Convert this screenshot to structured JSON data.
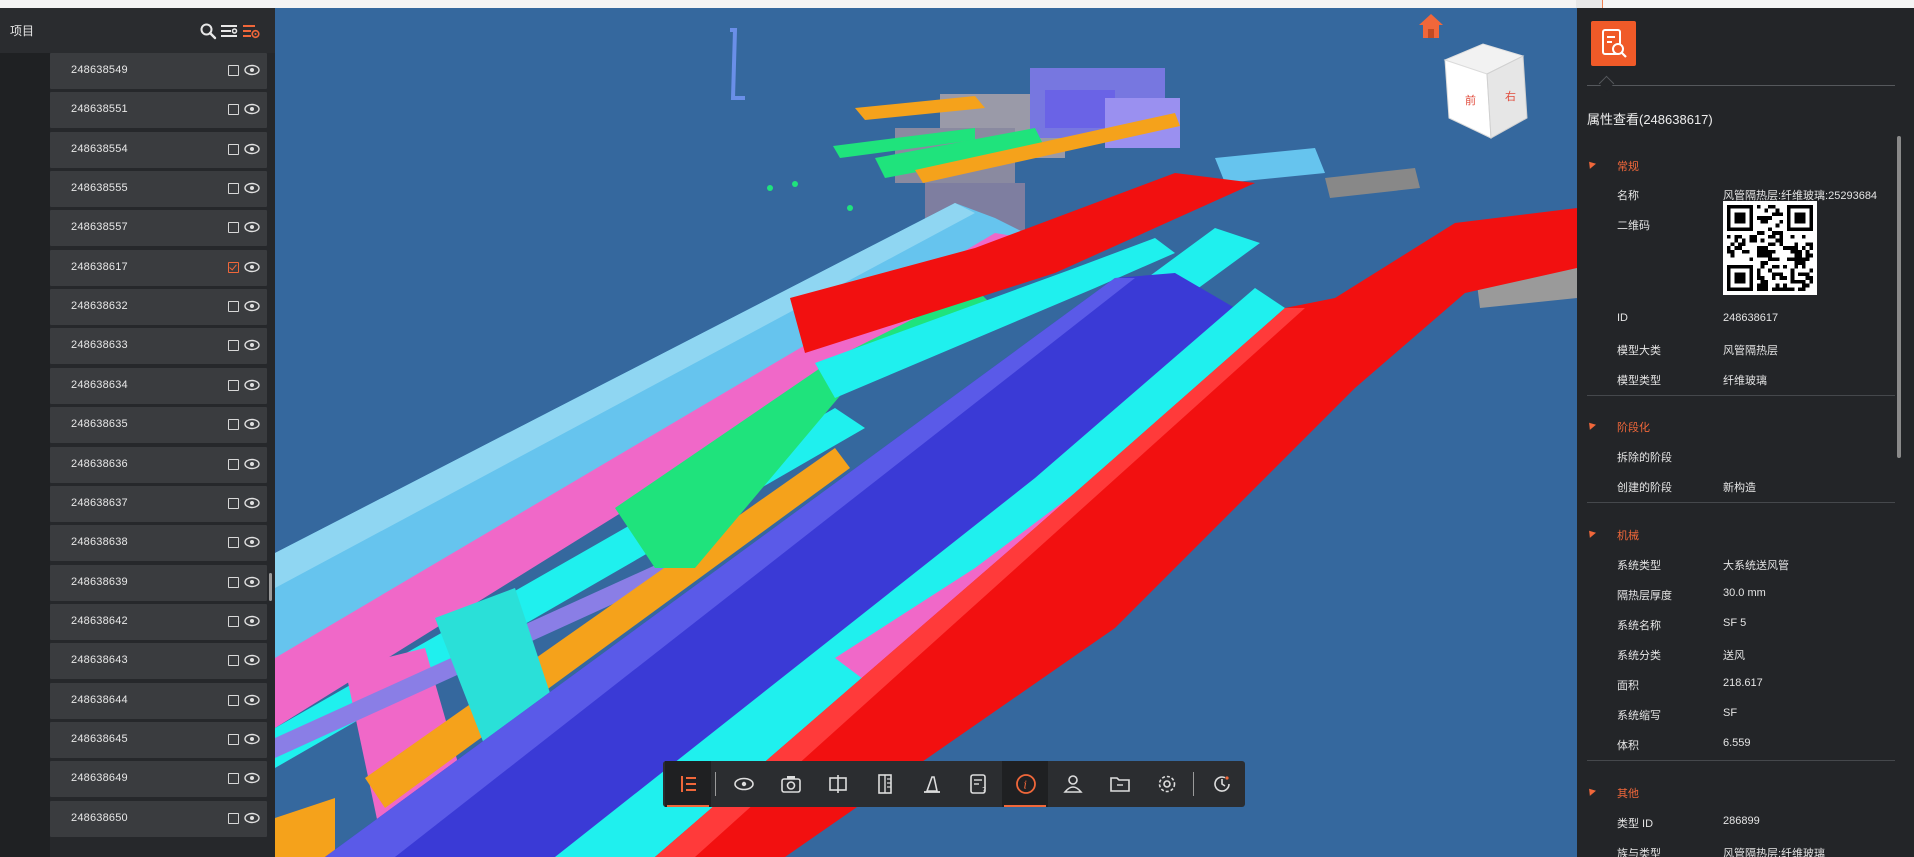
{
  "left_panel": {
    "title": "项目",
    "items": [
      {
        "label": "248638549",
        "checked": false
      },
      {
        "label": "248638551",
        "checked": false
      },
      {
        "label": "248638554",
        "checked": false
      },
      {
        "label": "248638555",
        "checked": false
      },
      {
        "label": "248638557",
        "checked": false
      },
      {
        "label": "248638617",
        "checked": true
      },
      {
        "label": "248638632",
        "checked": false
      },
      {
        "label": "248638633",
        "checked": false
      },
      {
        "label": "248638634",
        "checked": false
      },
      {
        "label": "248638635",
        "checked": false
      },
      {
        "label": "248638636",
        "checked": false
      },
      {
        "label": "248638637",
        "checked": false
      },
      {
        "label": "248638638",
        "checked": false
      },
      {
        "label": "248638639",
        "checked": false
      },
      {
        "label": "248638642",
        "checked": false
      },
      {
        "label": "248638643",
        "checked": false
      },
      {
        "label": "248638644",
        "checked": false
      },
      {
        "label": "248638645",
        "checked": false
      },
      {
        "label": "248638649",
        "checked": false
      },
      {
        "label": "248638650",
        "checked": false
      }
    ]
  },
  "viewport": {
    "background": "#35689e",
    "navcube_faces": [
      "前",
      "右"
    ],
    "duct_colors": {
      "cyan": "#1ff0ee",
      "light_blue": "#66c4ee",
      "pink": "#f068c8",
      "red": "#f21010",
      "blue": "#3a3ad6",
      "green": "#1fe37c",
      "orange": "#f5a21b",
      "violet": "#8a7ee6"
    }
  },
  "toolbar": {
    "buttons": [
      {
        "icon": "tree-list-icon",
        "active": true
      },
      {
        "icon": "eye-icon",
        "active": false
      },
      {
        "icon": "camera-icon",
        "active": false
      },
      {
        "icon": "section-box-icon",
        "active": false
      },
      {
        "icon": "measure-icon",
        "active": false
      },
      {
        "icon": "hammer-icon",
        "active": false
      },
      {
        "icon": "note-question-icon",
        "active": false
      },
      {
        "icon": "info-icon",
        "active": true
      },
      {
        "icon": "user-icon",
        "active": false
      },
      {
        "icon": "folder-icon",
        "active": false
      },
      {
        "icon": "settings-icon",
        "active": false
      },
      {
        "icon": "history-icon",
        "active": false
      }
    ]
  },
  "properties": {
    "title": "属性查看(248638617)",
    "accent": "#f0673a",
    "sections": [
      {
        "name": "常规",
        "rows": [
          {
            "key": "名称",
            "value": "风管隔热层:纤维玻璃:25293684"
          },
          {
            "key": "二维码",
            "value": ""
          },
          {
            "key": "ID",
            "value": "248638617"
          },
          {
            "key": "模型大类",
            "value": "风管隔热层"
          },
          {
            "key": "模型类型",
            "value": "纤维玻璃"
          }
        ]
      },
      {
        "name": "阶段化",
        "rows": [
          {
            "key": "拆除的阶段",
            "value": ""
          },
          {
            "key": "创建的阶段",
            "value": "新构造"
          }
        ]
      },
      {
        "name": "机械",
        "rows": [
          {
            "key": "系统类型",
            "value": "大系统送风管"
          },
          {
            "key": "隔热层厚度",
            "value": "30.0 mm"
          },
          {
            "key": "系统名称",
            "value": "SF 5"
          },
          {
            "key": "系统分类",
            "value": "送风"
          },
          {
            "key": "面积",
            "value": "218.617"
          },
          {
            "key": "系统缩写",
            "value": "SF"
          },
          {
            "key": "体积",
            "value": "6.559"
          }
        ]
      },
      {
        "name": "其他",
        "rows": [
          {
            "key": "类型 ID",
            "value": "286899"
          },
          {
            "key": "族与类型",
            "value": "风管隔热层:纤维玻璃"
          }
        ]
      }
    ]
  }
}
